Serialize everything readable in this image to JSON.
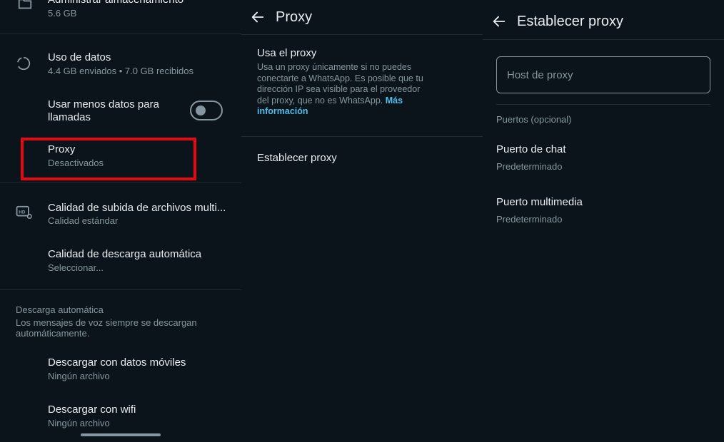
{
  "left": {
    "storage": {
      "title": "Administrar almacenamiento",
      "subtitle": "5.6 GB"
    },
    "data_usage": {
      "title": "Uso de datos",
      "subtitle": "4.4 GB enviados • 7.0 GB recibidos"
    },
    "less_data": {
      "line1": "Usar menos datos para",
      "line2": "llamadas"
    },
    "proxy": {
      "title": "Proxy",
      "subtitle": "Desactivados"
    },
    "upload_quality": {
      "title": "Calidad de subida de archivos multi...",
      "subtitle": "Calidad estándar"
    },
    "auto_download_quality": {
      "title": "Calidad de descarga automática",
      "subtitle": "Seleccionar..."
    },
    "auto_download_section": {
      "heading": "Descarga automática",
      "desc_line1": "Los mensajes de voz siempre se descargan",
      "desc_line2": "automáticamente."
    },
    "mobile_data": {
      "title": "Descargar con datos móviles",
      "subtitle": "Ningún archivo"
    },
    "wifi": {
      "title": "Descargar con wifi",
      "subtitle": "Ningún archivo"
    }
  },
  "middle": {
    "header_title": "Proxy",
    "use_proxy": {
      "title": "Usa el proxy",
      "desc_lines": [
        "Usa un proxy únicamente si no puedes",
        "conectarte a WhatsApp. Es posible que tu",
        "dirección IP sea visible para el proveedor",
        "del proxy, que no es WhatsApp."
      ],
      "link_part1": "Más",
      "link_part2": "información"
    },
    "set_proxy": "Establecer proxy"
  },
  "right": {
    "header_title": "Establecer proxy",
    "host_placeholder": "Host de proxy",
    "ports_heading": "Puertos (opcional)",
    "chat_port": {
      "title": "Puerto de chat",
      "subtitle": "Predeterminado"
    },
    "media_port": {
      "title": "Puerto multimedia",
      "subtitle": "Predeterminado"
    }
  },
  "icons": {
    "storage": "folder-icon",
    "data_usage": "data-usage-icon",
    "upload_quality": "hd-settings-icon",
    "back": "back-arrow-icon"
  },
  "colors": {
    "background": "#0b141a",
    "primary_text": "#e9edef",
    "secondary_text": "#8696a0",
    "link": "#53bdeb",
    "highlight": "#e50914"
  }
}
